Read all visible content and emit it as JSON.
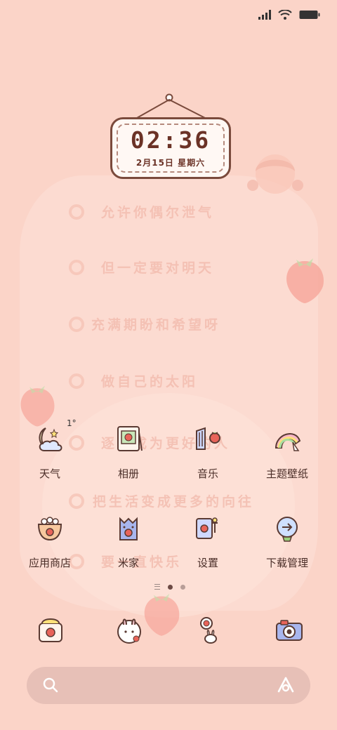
{
  "status_bar": {
    "signal": "signal-icon",
    "wifi": "wifi-icon",
    "battery": "battery-icon"
  },
  "clock_widget": {
    "time": "02:36",
    "date": "2月15日 星期六"
  },
  "faded_lines": [
    "允许你偶尔泄气",
    "但一定要对明天",
    "充满期盼和希望呀",
    "做自己的太阳",
    "逐渐成为更好的人",
    "把生活变成更多的向往",
    "要一直快乐"
  ],
  "weather": {
    "temp": "1°"
  },
  "apps": [
    {
      "label": "天气",
      "icon": "weather-moon-icon"
    },
    {
      "label": "相册",
      "icon": "album-icon"
    },
    {
      "label": "音乐",
      "icon": "music-icon"
    },
    {
      "label": "主题壁纸",
      "icon": "theme-wallpaper-icon"
    },
    {
      "label": "应用商店",
      "icon": "app-store-icon"
    },
    {
      "label": "米家",
      "icon": "mijia-icon"
    },
    {
      "label": "设置",
      "icon": "settings-icon"
    },
    {
      "label": "下载管理",
      "icon": "download-manager-icon"
    }
  ],
  "dock": [
    "phone-icon",
    "bunny-contacts-icon",
    "messages-icon",
    "camera-icon"
  ],
  "search": {
    "placeholder": ""
  },
  "colors": {
    "background": "#fbd4c8",
    "clock_text": "#6b3226",
    "label_text": "#4a2e28"
  }
}
